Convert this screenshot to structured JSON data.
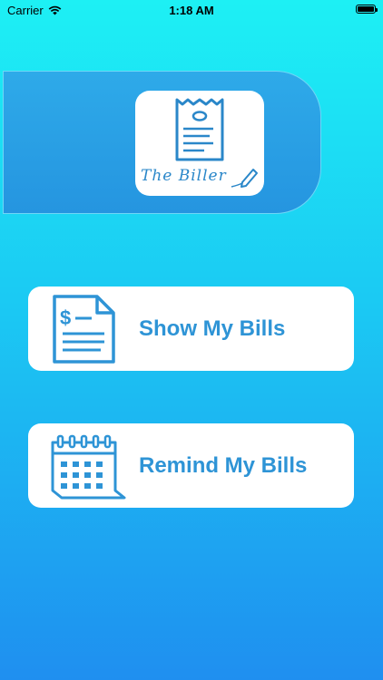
{
  "status_bar": {
    "carrier": "Carrier",
    "time": "1:18 AM"
  },
  "logo": {
    "text": "The Biller"
  },
  "buttons": {
    "show_bills": "Show My Bills",
    "remind_bills": "Remind My Bills"
  },
  "colors": {
    "accent": "#2e94d6",
    "gradient_top": "#1df0f4",
    "gradient_bottom": "#1f8ff0",
    "banner": "#2595e0"
  }
}
